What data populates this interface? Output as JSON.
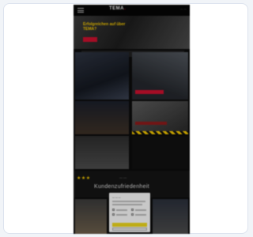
{
  "header": {
    "logo": "TEMA",
    "right_text": "···  ···"
  },
  "hero": {
    "title": "Erfolgreichen auf über TEMA?"
  },
  "headline": {
    "stars": "★★★",
    "kicker": "— —",
    "text": "Kundenzufriedenheit"
  },
  "cookie": {
    "title": "— — —"
  },
  "colors": {
    "accent_yellow": "#f0c400",
    "accent_red": "#c8102e",
    "background": "#0c0c0c"
  }
}
